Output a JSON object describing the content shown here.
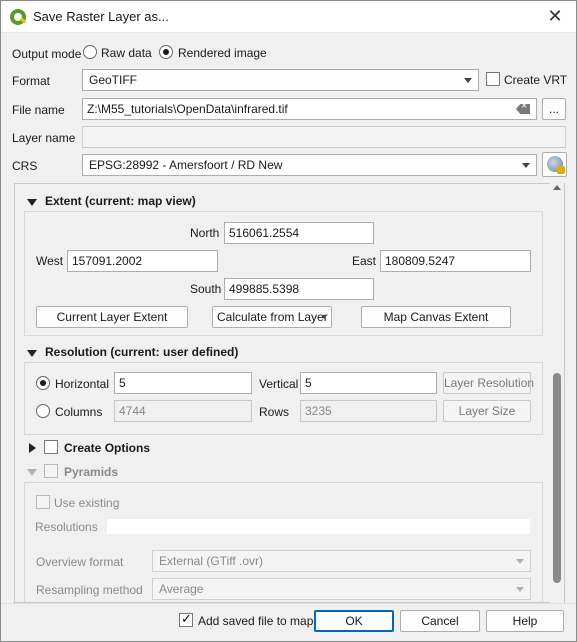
{
  "window": {
    "title": "Save Raster Layer as...",
    "close_glyph": "✕"
  },
  "output_mode": {
    "label": "Output mode",
    "options": [
      "Raw data",
      "Rendered image"
    ],
    "selected": "Rendered image"
  },
  "format": {
    "label": "Format",
    "value": "GeoTIFF",
    "create_vrt_label": "Create VRT",
    "create_vrt_checked": false
  },
  "file_name": {
    "label": "File name",
    "value": "Z:\\M55_tutorials\\OpenData\\infrared.tif",
    "browse_label": "..."
  },
  "layer_name": {
    "label": "Layer name",
    "value": ""
  },
  "crs": {
    "label": "CRS",
    "value": "EPSG:28992 - Amersfoort / RD New"
  },
  "extent": {
    "title": "Extent (current: map view)",
    "north_label": "North",
    "north": "516061.2554",
    "west_label": "West",
    "west": "157091.2002",
    "east_label": "East",
    "east": "180809.5247",
    "south_label": "South",
    "south": "499885.5398",
    "current_layer_extent": "Current Layer Extent",
    "calculate_from_layer": "Calculate from Layer",
    "map_canvas_extent": "Map Canvas Extent"
  },
  "resolution": {
    "title": "Resolution (current: user defined)",
    "horizontal_label": "Horizontal",
    "horizontal": "5",
    "vertical_label": "Vertical",
    "vertical": "5",
    "layer_resolution": "Layer Resolution",
    "columns_label": "Columns",
    "columns": "4744",
    "rows_label": "Rows",
    "rows": "3235",
    "layer_size": "Layer Size",
    "selected": "Horizontal"
  },
  "create_options": {
    "title": "Create Options",
    "checked": false
  },
  "pyramids": {
    "title": "Pyramids",
    "use_existing_label": "Use existing",
    "resolutions_label": "Resolutions",
    "resolutions_value": "",
    "overview_format_label": "Overview format",
    "overview_format": "External (GTiff .ovr)",
    "resampling_label": "Resampling method",
    "resampling": "Average"
  },
  "footer": {
    "add_saved_label": "Add saved file to map",
    "add_saved_checked": true,
    "ok": "OK",
    "cancel": "Cancel",
    "help": "Help"
  },
  "colors": {
    "accent": "#0067c0",
    "qgis_green": "#5a9a2a",
    "qgis_yellow": "#f2c200"
  }
}
